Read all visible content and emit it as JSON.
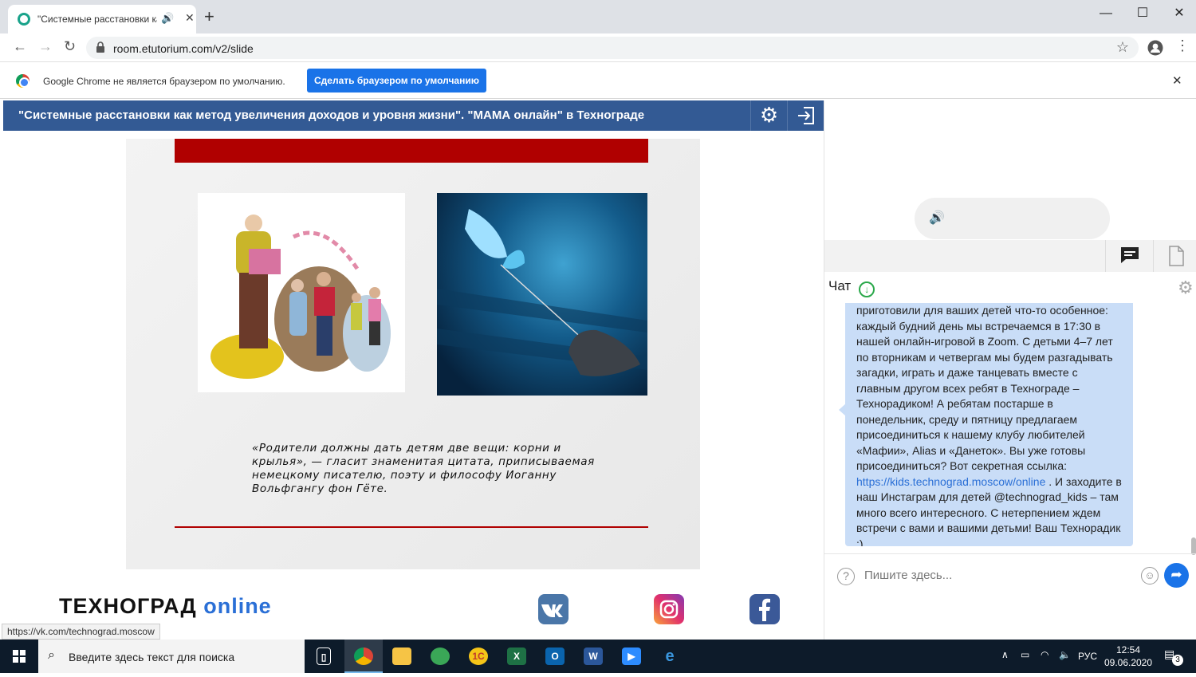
{
  "browser": {
    "tab_title": "\"Системные расстановки ка",
    "url": "room.etutorium.com/v2/slide",
    "infobar_message": "Google Chrome не является браузером по умолчанию.",
    "infobar_button": "Сделать браузером по умолчанию",
    "status_link": "https://vk.com/technograd.moscow"
  },
  "header": {
    "title": "\"Системные расстановки как метод увеличения доходов и уровня жизни\". \"МАМА онлайн\" в Технограде"
  },
  "slide": {
    "quote": "«Родители должны дать детям две вещи: корни и крылья», — гласит знаменитая цитата, приписываемая немецкому писателю, поэту и философу Иоганну Вольфгангу фон Гёте."
  },
  "footer": {
    "logo_main": "ТЕХНОГРАД",
    "logo_online": "online"
  },
  "chat": {
    "title": "Чат",
    "message_part1": "приготовили для ваших детей что-то особенное: каждый будний день мы встречаемся в 17:30 в нашей онлайн-игровой в Zoom. С детьми 4–7 лет по вторникам и четвергам мы будем разгадывать загадки, играть и даже танцевать вместе с главным другом всех ребят в Технограде – Технорадиком! А ребятам постарше в понедельник, среду и пятницу предлагаем присоединиться к нашему клубу любителей «Мафии», Alias и «Данеток». Вы уже готовы присоединиться? Вот секретная ссылка: ",
    "message_link": "https://kids.technograd.moscow/online",
    "message_part2": " . И заходите в наш Инстаграм для детей @technograd_kids – там много всего интересного. С нетерпением ждем встречи с вами и вашими детьми! Ваш Технорадик :)",
    "input_placeholder": "Пишите здесь..."
  },
  "taskbar": {
    "search_placeholder": "Введите здесь текст для поиска",
    "language": "РУС",
    "time": "12:54",
    "date": "09.06.2020",
    "notifications": "3"
  },
  "colors": {
    "header_bg": "#335a94",
    "accent_blue": "#1a73e8",
    "slide_red": "#b00000",
    "chat_bubble": "#c9ddf7"
  }
}
